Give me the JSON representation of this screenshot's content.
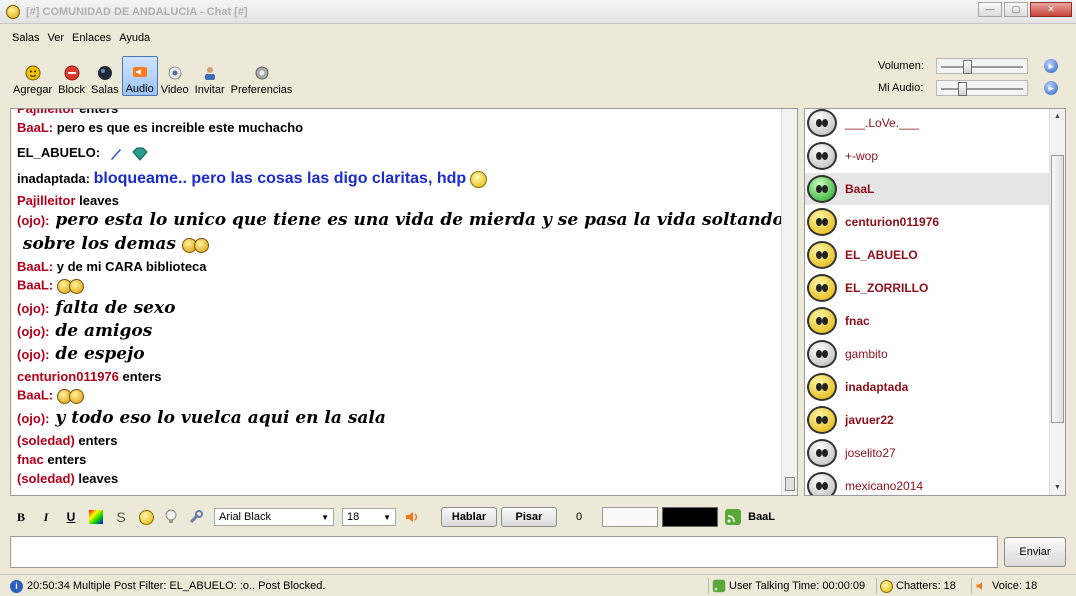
{
  "window": {
    "title": "[#] COMUNIDAD DE ANDALUCIA - Chat [#]"
  },
  "menu": [
    "Salas",
    "Ver",
    "Enlaces",
    "Ayuda"
  ],
  "toolbar": [
    {
      "label": "Agregar",
      "icon": "add-user-icon"
    },
    {
      "label": "Block",
      "icon": "block-icon"
    },
    {
      "label": "Salas",
      "icon": "rooms-icon"
    },
    {
      "label": "Audio",
      "icon": "audio-icon",
      "active": true
    },
    {
      "label": "Video",
      "icon": "video-icon"
    },
    {
      "label": "Invitar",
      "icon": "invite-icon"
    },
    {
      "label": "Preferencias",
      "icon": "preferences-icon"
    }
  ],
  "volume": {
    "label": "Volumen:",
    "level": 0.27
  },
  "mic": {
    "label": "Mi Audio:",
    "level": 0.21
  },
  "messages": [
    {
      "nick": "Pajilleitor",
      "text": "enters"
    },
    {
      "nick": "BaaL:",
      "text": "pero es que es increible este muchacho"
    },
    {
      "nick": "EL_ABUELO:",
      "text": "",
      "color": "#000000"
    },
    {
      "nick": "inadaptada:",
      "text": "bloqueame.. pero las cosas las digo claritas, hdp",
      "color": "#000000"
    },
    {
      "nick": "Pajilleitor",
      "text": "leaves"
    },
    {
      "nick": "(ojo):",
      "text": "pero esta lo unico que tiene es una vida de mierda y se pasa la vida soltando la bilis"
    },
    {
      "nick": "",
      "text": "sobre los demas"
    },
    {
      "nick": "BaaL:",
      "text": "y de mi CARA biblioteca"
    },
    {
      "nick": "BaaL:",
      "text": ""
    },
    {
      "nick": "(ojo):",
      "text": "falta de sexo"
    },
    {
      "nick": "(ojo):",
      "text": "de amigos"
    },
    {
      "nick": "(ojo):",
      "text": "de espejo"
    },
    {
      "nick": "centurion011976",
      "text": "enters"
    },
    {
      "nick": "BaaL:",
      "text": ""
    },
    {
      "nick": "(ojo):",
      "text": "y todo eso lo vuelca aqui en la sala"
    },
    {
      "nick": "(soledad)",
      "text": "enters"
    },
    {
      "nick": "fnac",
      "text": "enters"
    },
    {
      "nick": "(soledad)",
      "text": "leaves"
    }
  ],
  "users": [
    {
      "name": "___.LoVe.___",
      "face": "gray",
      "bold": false
    },
    {
      "name": "+-wop",
      "face": "gray",
      "bold": false
    },
    {
      "name": "BaaL",
      "face": "green",
      "bold": true,
      "selected": true
    },
    {
      "name": "centurion011976",
      "face": "yellow",
      "bold": true
    },
    {
      "name": "EL_ABUELO",
      "face": "yellow",
      "bold": true
    },
    {
      "name": "EL_ZORRILLO",
      "face": "yellow",
      "bold": true
    },
    {
      "name": "fnac",
      "face": "yellow",
      "bold": true
    },
    {
      "name": "gambito",
      "face": "gray",
      "bold": false
    },
    {
      "name": "inadaptada",
      "face": "yellow",
      "bold": true
    },
    {
      "name": "javuer22",
      "face": "yellow",
      "bold": true
    },
    {
      "name": "joselito27",
      "face": "gray",
      "bold": false
    },
    {
      "name": "mexicano2014",
      "face": "gray",
      "bold": false
    }
  ],
  "format": {
    "font": "Arial Black",
    "size": "18",
    "talk_label": "Hablar",
    "push_label": "Pisar",
    "counter": "0",
    "nick": "BaaL"
  },
  "send_label": "Enviar",
  "status": {
    "message": "20:50:34 Multiple Post Filter: EL_ABUELO: :o.. Post Blocked.",
    "talking": "User Talking Time: 00:00:09",
    "chatters": "Chatters: 18",
    "voice": "Voice: 18"
  }
}
